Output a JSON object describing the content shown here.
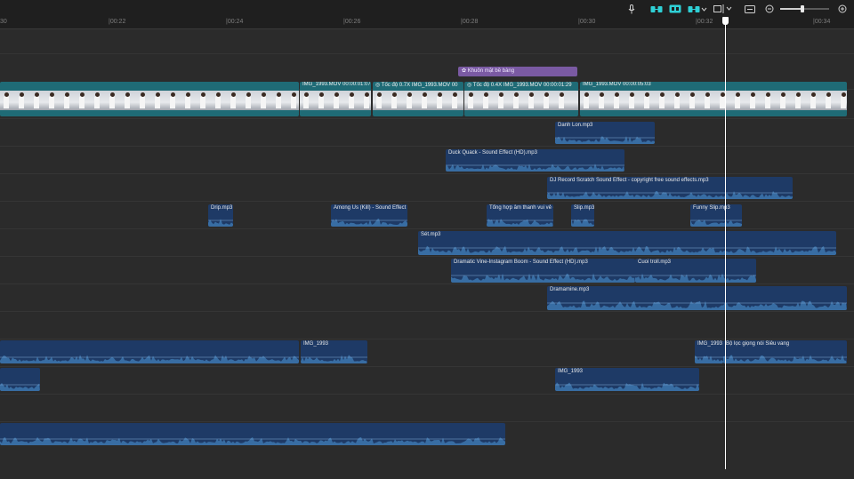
{
  "toolbar": {
    "icons": [
      "microphone-icon",
      "link-clips-icon",
      "magnet-snap-icon",
      "linked-selection-icon",
      "preview-axis-icon",
      "fit-timeline-icon",
      "zoom-out-icon",
      "zoom-in-icon"
    ],
    "zoom_level": 0.46,
    "accent_color": "#2fd0d6"
  },
  "ruler": {
    "ticks": [
      "|00:22",
      "|00:24",
      "|00:26",
      "|00:28",
      "|00:30",
      "|00:32",
      "|00:34"
    ],
    "edge_left": "30"
  },
  "sticker_clip": {
    "label": "Khuôn mặt bề bàng"
  },
  "video_clips": [
    {
      "label": ""
    },
    {
      "label": "IMG_1993.MOV   00:00:01:07"
    },
    {
      "label": "Tốc độ 0.7X   IMG_1993.MOV   00"
    },
    {
      "label": "Tốc độ 0.4X   IMG_1993.MOV   00:00:01:29"
    },
    {
      "label": "IMG_1993.MOV   00:00:05:03"
    }
  ],
  "audio_clips": [
    {
      "label": "Danh Lon.mp3"
    },
    {
      "label": "Duck Quack - Sound Effect (HD).mp3"
    },
    {
      "label": "DJ Record Scratch Sound Effect - copyright free sound effects.mp3"
    },
    {
      "label": "Drip.mp3"
    },
    {
      "label": "Among Us (Kill) - Sound Effect ("
    },
    {
      "label": "Tổng hợp âm thanh vui vẻ ch"
    },
    {
      "label": "Slip.mp3"
    },
    {
      "label": "Funny Slip.mp3"
    },
    {
      "label": "Sét.mp3"
    },
    {
      "label": "Dramatic Vine-Instagram Boom - Sound Effect (HD).mp3"
    },
    {
      "label": "Cuoi troll.mp3"
    },
    {
      "label": "Dramamine.mp3"
    },
    {
      "label": ""
    },
    {
      "label": "IMG_1993"
    },
    {
      "label": "IMG_1993"
    },
    {
      "label": "Bộ lọc giọng nói Siêu vang"
    },
    {
      "label": ""
    },
    {
      "label": "IMG_1993"
    },
    {
      "label": ""
    }
  ],
  "colors": {
    "audio_clip": "#1e3a66",
    "video_clip": "#1f6b76",
    "sticker": "#7a5aa3",
    "playhead": "#ffffff"
  }
}
